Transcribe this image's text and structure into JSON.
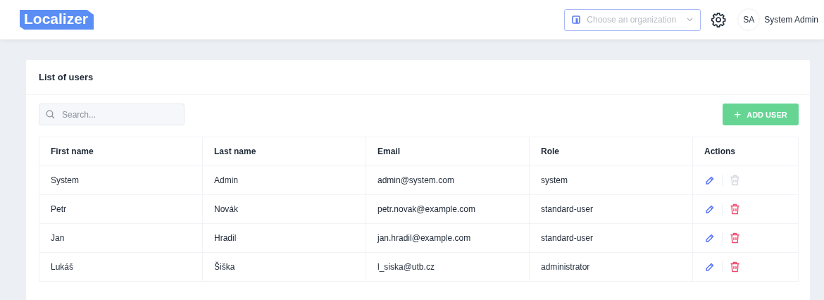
{
  "header": {
    "logo": "Localizer",
    "organization_select": {
      "placeholder": "Choose an organization"
    },
    "user": {
      "initials": "SA",
      "name": "System Admin"
    }
  },
  "card": {
    "title": "List of users",
    "search": {
      "placeholder": "Search..."
    },
    "add_button": {
      "icon": "+",
      "label": "ADD USER"
    },
    "table": {
      "columns": [
        "First name",
        "Last name",
        "Email",
        "Role",
        "Actions"
      ],
      "rows": [
        {
          "cells": [
            "System",
            "Admin",
            "admin@system.com",
            "system"
          ],
          "delete_disabled": true
        },
        {
          "cells": [
            "Petr",
            "Novák",
            "petr.novak@example.com",
            "standard-user"
          ],
          "delete_disabled": false
        },
        {
          "cells": [
            "Jan",
            "Hradil",
            "jan.hradil@example.com",
            "standard-user"
          ],
          "delete_disabled": false
        },
        {
          "cells": [
            "Lukáš",
            "Šiška",
            "l_siska@utb.cz",
            "administrator"
          ],
          "delete_disabled": false
        }
      ]
    }
  }
}
